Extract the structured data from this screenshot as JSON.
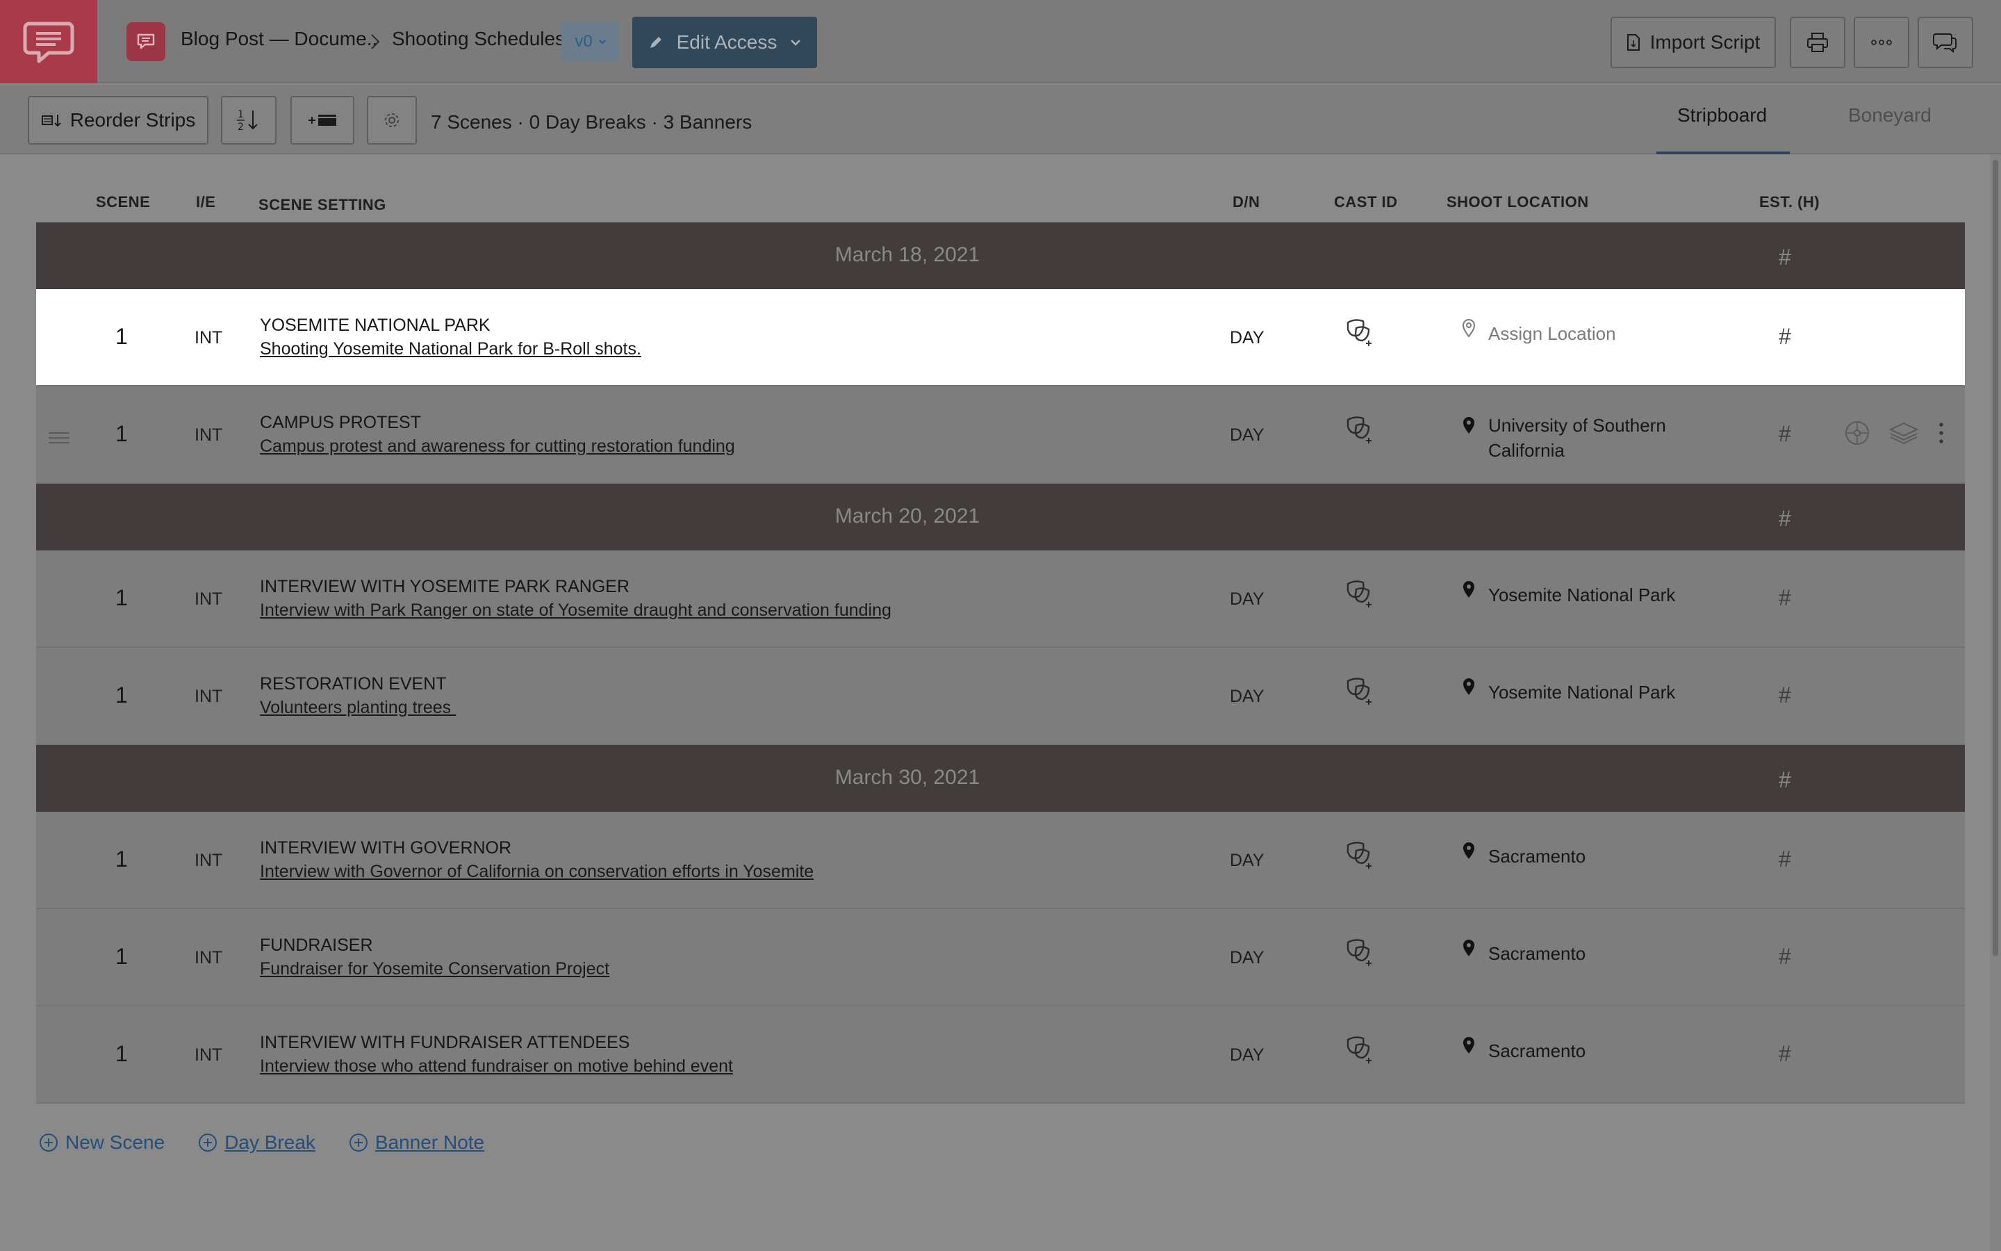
{
  "header": {
    "doc_title": "Blog Post — Docume..",
    "section": "Shooting Schedules",
    "version": "v0",
    "edit_access": "Edit Access",
    "import_script": "Import Script"
  },
  "toolbar": {
    "reorder_strips": "Reorder Strips",
    "summary": "7 Scenes · 0 Day Breaks · 3 Banners",
    "tabs": [
      {
        "label": "Stripboard",
        "active": true
      },
      {
        "label": "Boneyard",
        "active": false
      }
    ]
  },
  "columns": {
    "scene": "SCENE",
    "ie": "I/E",
    "setting": "SCENE SETTING",
    "dn": "D/N",
    "cast": "CAST ID",
    "location": "SHOOT LOCATION",
    "est": "EST. (H)"
  },
  "banners": [
    {
      "date": "March 18, 2021",
      "hours": "#"
    },
    {
      "date": "March 20, 2021",
      "hours": "#"
    },
    {
      "date": "March 30, 2021",
      "hours": "#"
    }
  ],
  "scenes": [
    {
      "number": "1",
      "ie": "INT",
      "title": "YOSEMITE NATIONAL PARK",
      "description": "Shooting Yosemite National Park for B-Roll shots.",
      "dn": "DAY",
      "location": "Assign Location",
      "hours": "#"
    },
    {
      "number": "1",
      "ie": "INT",
      "title": "CAMPUS PROTEST",
      "description": "Campus protest and awareness for cutting restoration funding",
      "dn": "DAY",
      "location": "University of Southern California",
      "hours": "#"
    },
    {
      "number": "1",
      "ie": "INT",
      "title": "INTERVIEW WITH YOSEMITE PARK RANGER",
      "description": "Interview with Park Ranger on state of Yosemite draught and conservation funding",
      "dn": "DAY",
      "location": "Yosemite National Park",
      "hours": "#"
    },
    {
      "number": "1",
      "ie": "INT",
      "title": "RESTORATION EVENT",
      "description": "Volunteers planting trees ",
      "dn": "DAY",
      "location": "Yosemite National Park",
      "hours": "#"
    },
    {
      "number": "1",
      "ie": "INT",
      "title": "INTERVIEW WITH GOVERNOR",
      "description": "Interview with Governor of California on conservation efforts in Yosemite",
      "dn": "DAY",
      "location": "Sacramento",
      "hours": "#"
    },
    {
      "number": "1",
      "ie": "INT",
      "title": "FUNDRAISER",
      "description": "Fundraiser for Yosemite Conservation Project",
      "dn": "DAY",
      "location": "Sacramento",
      "hours": "#"
    },
    {
      "number": "1",
      "ie": "INT",
      "title": "INTERVIEW WITH FUNDRAISER ATTENDEES",
      "description": "Interview those who attend fundraiser on motive behind event",
      "dn": "DAY",
      "location": "Sacramento",
      "hours": "#"
    }
  ],
  "footer": {
    "new_scene": "New Scene",
    "day_break": "Day Break",
    "banner_note": "Banner Note"
  },
  "colors": {
    "brand": "#a83a4a",
    "edit_access_bg": "#31475a",
    "banner_bg": "#423c3c",
    "link": "#254e78"
  }
}
